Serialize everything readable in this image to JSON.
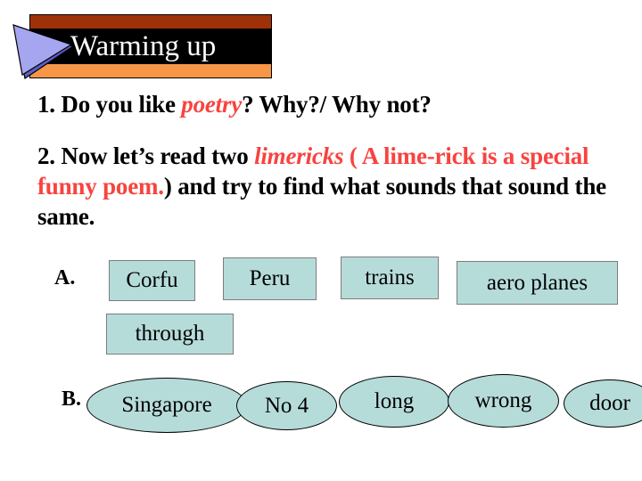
{
  "slide": {
    "title": "Warming up",
    "background_color": "#ffffff"
  },
  "banner": {
    "title": "Warming up",
    "stripe_top_color": "#9E3108",
    "band_color": "#000000",
    "stripe_bottom_color": "#F79646",
    "title_color": "#ffffff",
    "arrow_fill": "#A5A5F0",
    "arrow_shadow": "#5C5CC8"
  },
  "questions": {
    "q1": {
      "number": "1.",
      "part1": " Do you like ",
      "highlight": "poetry",
      "part2": "? Why?/ Why not?"
    },
    "q2": {
      "number": "2.",
      "part1": " Now let’s read two ",
      "highlight_italic": "limericks",
      "paren_open": " ( ",
      "paren_text": "A lime-rick is a special funny poem.",
      "paren_close": ")",
      "part2": " and try to find what sounds that sound the same."
    },
    "accent_color": "#F8433F"
  },
  "group_a": {
    "label": "A.",
    "shape": "rectangle",
    "fill_color": "#B6DCDA",
    "border_color": "#7C7C7C",
    "items": [
      {
        "text": "Corfu"
      },
      {
        "text": "Peru"
      },
      {
        "text": "trains"
      },
      {
        "text": "aero planes"
      },
      {
        "text": "through"
      }
    ]
  },
  "group_b": {
    "label": "B.",
    "shape": "ellipse",
    "fill_color": "#B6DCDA",
    "border_color": "#000000",
    "items": [
      {
        "text": "Singapore"
      },
      {
        "text": "No 4"
      },
      {
        "text": "long"
      },
      {
        "text": "wrong"
      },
      {
        "text": "door"
      }
    ]
  }
}
